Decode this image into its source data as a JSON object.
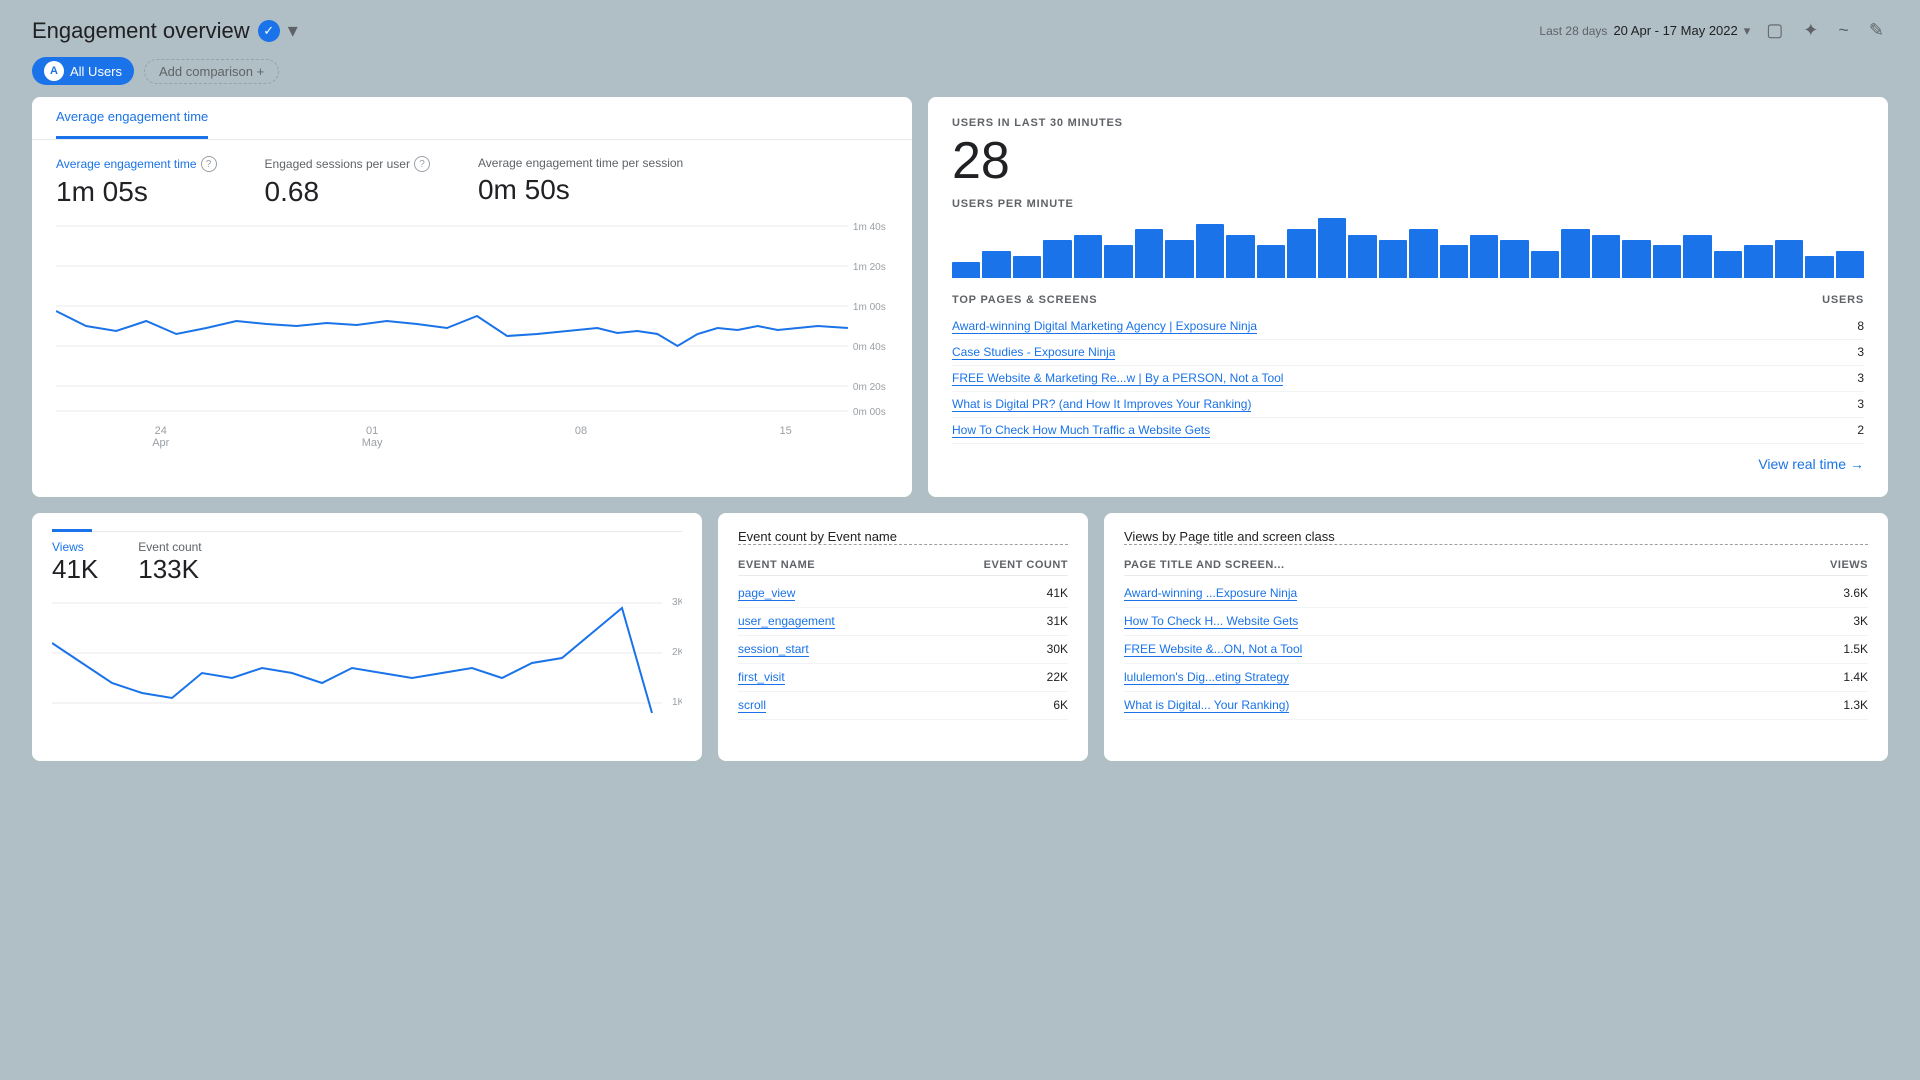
{
  "header": {
    "title": "Engagement overview",
    "date_label": "Last 28 days",
    "date_value": "20 Apr - 17 May 2022"
  },
  "filter": {
    "user_label": "All Users",
    "add_comparison": "Add comparison +"
  },
  "engagement": {
    "tab_label": "Average engagement time",
    "metric1": {
      "label": "Average engagement time",
      "value": "1m 05s"
    },
    "metric2": {
      "label": "Engaged sessions per user",
      "value": "0.68"
    },
    "metric3": {
      "label": "Average engagement time per session",
      "value": "0m 50s"
    },
    "x_labels": [
      "24\nApr",
      "01\nMay",
      "08",
      "15"
    ],
    "y_labels": [
      "1m 40s",
      "1m 20s",
      "1m 00s",
      "0m 40s",
      "0m 20s",
      "0m 00s"
    ]
  },
  "realtime": {
    "section_label": "USERS IN LAST 30 MINUTES",
    "big_number": "28",
    "sub_label": "USERS PER MINUTE",
    "bars": [
      3,
      5,
      4,
      7,
      8,
      6,
      9,
      7,
      10,
      8,
      6,
      9,
      11,
      8,
      7,
      9,
      6,
      8,
      7,
      5,
      9,
      8,
      7,
      6,
      8,
      5,
      6,
      7,
      4,
      5
    ],
    "pages_header": "TOP PAGES & SCREENS",
    "users_header": "USERS",
    "pages": [
      {
        "title": "Award-winning Digital Marketing Agency | Exposure Ninja",
        "count": "8"
      },
      {
        "title": "Case Studies - Exposure Ninja",
        "count": "3"
      },
      {
        "title": "FREE Website & Marketing Re...w | By a PERSON, Not a Tool",
        "count": "3"
      },
      {
        "title": "What is Digital PR? (and How It Improves Your Ranking)",
        "count": "3"
      },
      {
        "title": "How To Check How Much Traffic a Website Gets",
        "count": "2"
      }
    ],
    "view_realtime": "View real time"
  },
  "bottom_left": {
    "label1": "Views",
    "value1": "41K",
    "label2": "Event count",
    "value2": "133K"
  },
  "bottom_mid": {
    "title": "Event count by Event name",
    "col1": "EVENT NAME",
    "col2": "EVENT COUNT",
    "rows": [
      {
        "name": "page_view",
        "count": "41K"
      },
      {
        "name": "user_engagement",
        "count": "31K"
      },
      {
        "name": "session_start",
        "count": "30K"
      },
      {
        "name": "first_visit",
        "count": "22K"
      },
      {
        "name": "scroll",
        "count": "6K"
      }
    ]
  },
  "bottom_right": {
    "title": "Views by Page title and screen class",
    "col1": "PAGE TITLE AND SCREEN...",
    "col2": "VIEWS",
    "rows": [
      {
        "name": "Award-winning ...Exposure Ninja",
        "count": "3.6K"
      },
      {
        "name": "How To Check H... Website Gets",
        "count": "3K"
      },
      {
        "name": "FREE Website &...ON, Not a Tool",
        "count": "1.5K"
      },
      {
        "name": "lululemon's Dig...eting Strategy",
        "count": "1.4K"
      },
      {
        "name": "What is Digital... Your Ranking)",
        "count": "1.3K"
      }
    ]
  }
}
